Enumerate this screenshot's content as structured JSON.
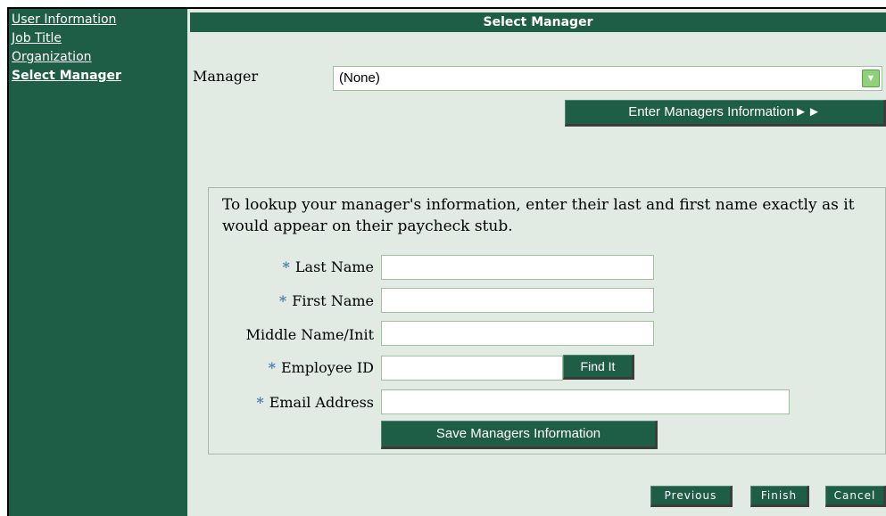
{
  "sidebar": {
    "items": [
      {
        "label": "User Information"
      },
      {
        "label": "Job Title"
      },
      {
        "label": "Organization"
      },
      {
        "label": "Select Manager"
      }
    ]
  },
  "main": {
    "title": "Select Manager",
    "manager_label": "Manager",
    "manager_select_value": "(None)",
    "enter_button": "Enter Managers Information►►",
    "lookup_text": "To lookup your manager's information, enter their last and first name exactly as it would appear on their paycheck stub.",
    "required_marker": "*",
    "fields": {
      "last_name": {
        "label": "Last Name",
        "value": ""
      },
      "first_name": {
        "label": "First Name",
        "value": ""
      },
      "middle_name": {
        "label": "Middle Name/Init",
        "value": ""
      },
      "employee_id": {
        "label": "Employee ID",
        "value": ""
      },
      "email": {
        "label": "Email Address",
        "value": ""
      }
    },
    "find_button": "Find It",
    "save_button": "Save Managers Information"
  },
  "footer": {
    "previous": "Previous",
    "finish": "Finish",
    "cancel": "Cancel"
  },
  "colors": {
    "primary": "#1f5e46",
    "background": "#e1ebe4",
    "required_star": "#4a7fb0"
  }
}
